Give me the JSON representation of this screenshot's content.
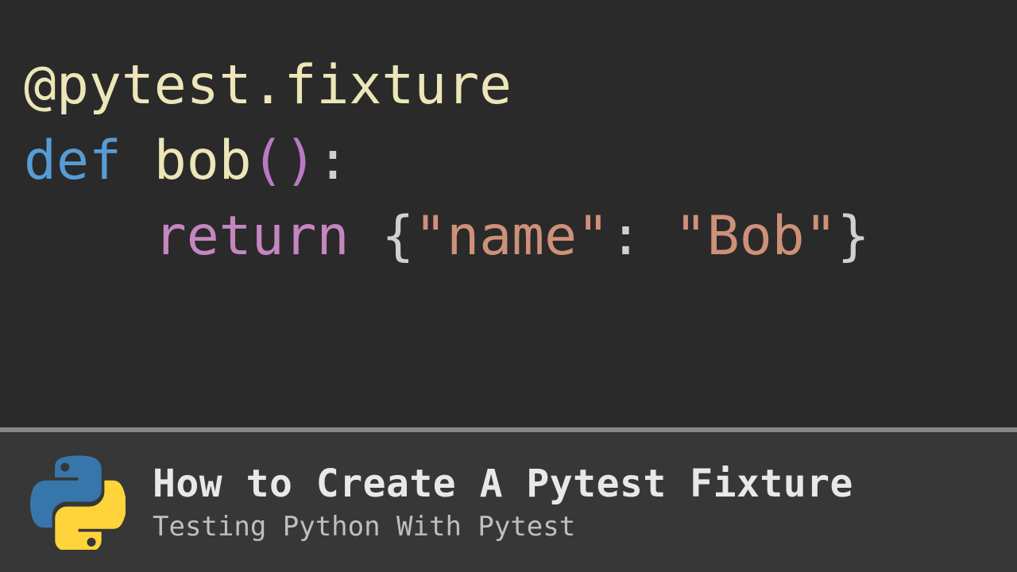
{
  "code": {
    "line1": {
      "decorator": "@pytest.fixture"
    },
    "line2": {
      "kw_def": "def",
      "space1": " ",
      "fn": "bob",
      "lparen": "(",
      "rparen": ")",
      "colon": ":"
    },
    "line3": {
      "indent": "    ",
      "kw_return": "return",
      "space1": " ",
      "lbrace": "{",
      "str_key": "\"name\"",
      "colon": ":",
      "space2": " ",
      "str_val": "\"Bob\"",
      "rbrace": "}"
    }
  },
  "footer": {
    "title": "How to Create A Pytest Fixture",
    "subtitle": "Testing Python With Pytest"
  },
  "colors": {
    "bg_code": "#2a2a2a",
    "bg_footer": "#373737",
    "keyword": "#569cd6",
    "decorator": "#ece6b8",
    "return": "#c586c0",
    "string": "#ce9178",
    "paren": "#ba79c7"
  }
}
